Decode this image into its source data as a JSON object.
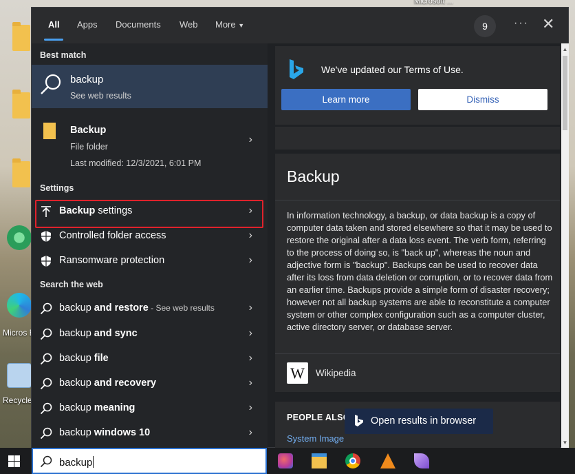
{
  "desktop": {
    "top_label": "Microsoft ...",
    "edge_label": "Micros Edge",
    "recycle_label": "Recycle"
  },
  "tabs": [
    {
      "label": "All",
      "active": true
    },
    {
      "label": "Apps"
    },
    {
      "label": "Documents"
    },
    {
      "label": "Web"
    },
    {
      "label": "More"
    }
  ],
  "header": {
    "badge_count": "9",
    "more_options": "···",
    "close": "✕"
  },
  "results": {
    "best_match_heading": "Best match",
    "best_match": {
      "title": "backup",
      "subtitle": "See web results",
      "icon": "search-icon"
    },
    "folder": {
      "title": "Backup",
      "type": "File folder",
      "modified": "Last modified: 12/3/2021, 6:01 PM",
      "icon": "folder-icon"
    },
    "settings_heading": "Settings",
    "settings": [
      {
        "bold": "Backup",
        "rest": " settings",
        "icon": "backup-arrow-icon",
        "highlighted": true
      },
      {
        "bold": "",
        "rest": "Controlled folder access",
        "icon": "shield-icon"
      },
      {
        "bold": "",
        "rest": "Ransomware protection",
        "icon": "shield-icon"
      }
    ],
    "web_heading": "Search the web",
    "web": [
      {
        "plain": "backup ",
        "bold": "and restore",
        "suffix": " - See web results"
      },
      {
        "plain": "backup ",
        "bold": "and sync",
        "suffix": ""
      },
      {
        "plain": "backup ",
        "bold": "file",
        "suffix": ""
      },
      {
        "plain": "backup ",
        "bold": "and recovery",
        "suffix": ""
      },
      {
        "plain": "backup ",
        "bold": "meaning",
        "suffix": ""
      },
      {
        "plain": "backup ",
        "bold": "windows 10",
        "suffix": ""
      }
    ]
  },
  "preview": {
    "terms_notice": "We've updated our Terms of Use.",
    "learn_more": "Learn more",
    "dismiss": "Dismiss",
    "title": "Backup",
    "body": "In information technology, a backup, or data backup is a copy of computer data taken and stored elsewhere so that it may be used to restore the original after a data loss event. The verb form, referring to the process of doing so, is \"back up\", whereas the noun and adjective form is \"backup\". Backups can be used to recover data after its loss from data deletion or corruption, or to recover data from an earlier time. Backups provide a simple form of disaster recovery; however not all backup systems are able to reconstitute a computer system or other complex configuration such as a computer cluster, active directory server, or database server.",
    "source": "Wikipedia",
    "source_logo": "W",
    "people_also": "PEOPLE ALSO",
    "related_link": "System Image",
    "open_in_browser": "Open results in browser"
  },
  "taskbar": {
    "search_value": "backup",
    "apps": [
      "paint-3d-icon",
      "file-explorer-icon",
      "chrome-icon",
      "vlc-icon",
      "feather-app-icon"
    ]
  },
  "colors": {
    "accent_blue": "#3b6fc2",
    "highlight_red": "#e0222c",
    "best_match_bg": "#2f3e54",
    "link_blue": "#73aef0"
  }
}
